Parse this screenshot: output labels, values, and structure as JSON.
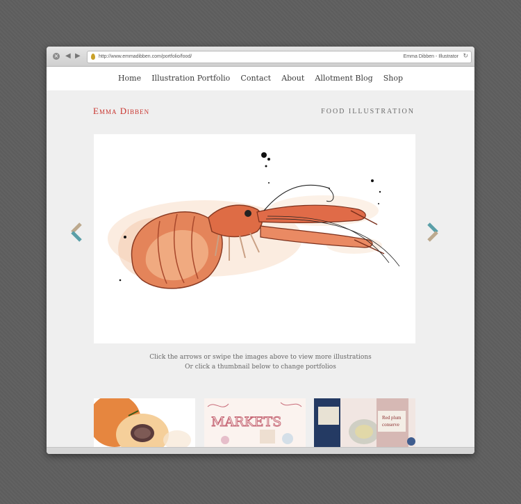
{
  "browser": {
    "url": "http://www.emmadibben.com/portfolio/food/",
    "page_title": "Emma Dibben - Illustrator"
  },
  "nav": {
    "items": [
      "Home",
      "Illustration Portfolio",
      "Contact",
      "About",
      "Allotment Blog",
      "Shop"
    ]
  },
  "header": {
    "logo": "Emma Dibben",
    "section_title": "FOOD ILLUSTRATION"
  },
  "caption": {
    "line1": "Click the arrows or swipe the images above to view more illustrations",
    "line2": "Or click a thumbnail below to change portfolios"
  },
  "thumbnails": {
    "markets_text": "MARKETS",
    "jar_label_1": "Red plum",
    "jar_label_2": "conserve"
  },
  "colors": {
    "logo_red": "#c8322c",
    "arrow_teal": "#5a9fa8",
    "arrow_tan": "#bca98e"
  }
}
